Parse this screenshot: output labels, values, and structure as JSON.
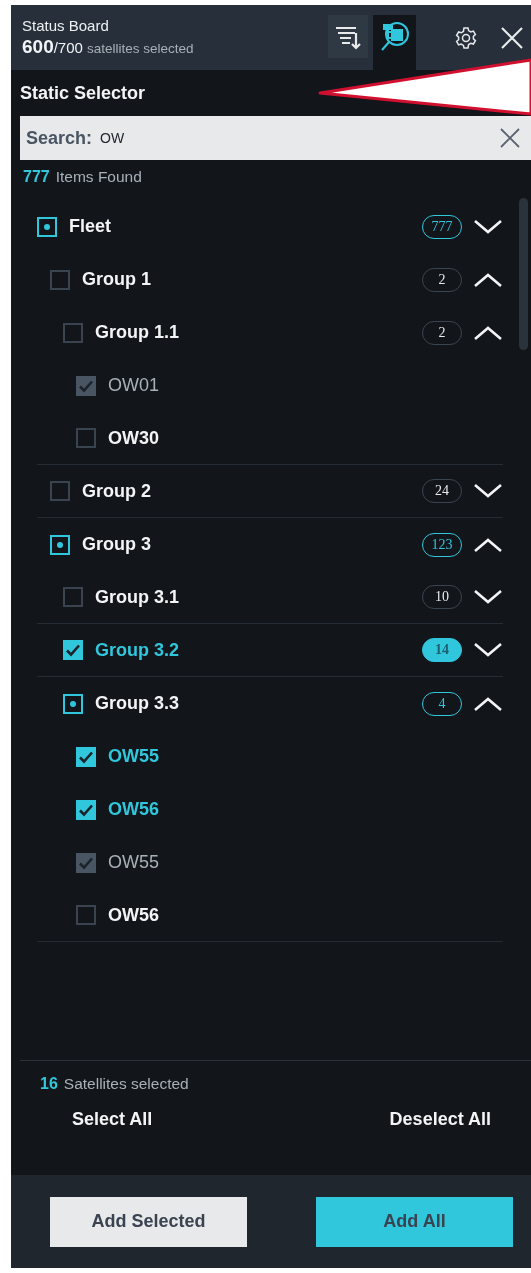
{
  "header": {
    "title": "Status Board",
    "selected_count": "600",
    "total": "/700",
    "caption": "satellites selected"
  },
  "tabs": [
    {
      "kind": "sort",
      "selected": false
    },
    {
      "kind": "tree-search",
      "selected": true
    }
  ],
  "section_title": "Static Selector",
  "search": {
    "label": "Search:",
    "value": "OW"
  },
  "results": {
    "count": "777",
    "label": "Items Found"
  },
  "tree": [
    {
      "label": "Fleet",
      "checked": false,
      "partial": true,
      "disabled": false,
      "count": "777",
      "expanded": false,
      "children": [
        {
          "label": "Group 1",
          "checked": false,
          "partial": false,
          "disabled": false,
          "count": "2",
          "expanded": true,
          "children": [
            {
              "label": "Group 1.1",
              "checked": false,
              "partial": false,
              "disabled": false,
              "count": "2",
              "expanded": true,
              "children": [
                {
                  "label": "OW01",
                  "checked": true,
                  "partial": false,
                  "disabled": true
                },
                {
                  "label": "OW30",
                  "checked": false,
                  "partial": false,
                  "disabled": false
                }
              ]
            }
          ]
        },
        {
          "label": "Group 2",
          "checked": false,
          "partial": false,
          "disabled": false,
          "count": "24",
          "expanded": false
        },
        {
          "label": "Group 3",
          "checked": false,
          "partial": true,
          "disabled": false,
          "count": "123",
          "expanded": true,
          "children": [
            {
              "label": "Group 3.1",
              "checked": false,
              "partial": false,
              "disabled": false,
              "count": "10",
              "expanded": false
            },
            {
              "label": "Group 3.2",
              "checked": true,
              "partial": false,
              "disabled": false,
              "count": "14",
              "expanded": false
            },
            {
              "label": "Group 3.3",
              "checked": false,
              "partial": true,
              "disabled": false,
              "count": "4",
              "expanded": true,
              "children": [
                {
                  "label": "OW55",
                  "checked": true,
                  "partial": false,
                  "disabled": false
                },
                {
                  "label": "OW56",
                  "checked": true,
                  "partial": false,
                  "disabled": false
                },
                {
                  "label": "OW55",
                  "checked": true,
                  "partial": false,
                  "disabled": true
                },
                {
                  "label": "OW56",
                  "checked": false,
                  "partial": false,
                  "disabled": false
                }
              ]
            }
          ]
        }
      ]
    }
  ],
  "footer": {
    "count": "16",
    "label": "Satellites selected",
    "select_all": "Select All",
    "deselect_all": "Deselect All"
  },
  "buttons": [
    {
      "label": "Add Selected",
      "kind": "secondary"
    },
    {
      "label": "Add All",
      "kind": "primary"
    }
  ]
}
